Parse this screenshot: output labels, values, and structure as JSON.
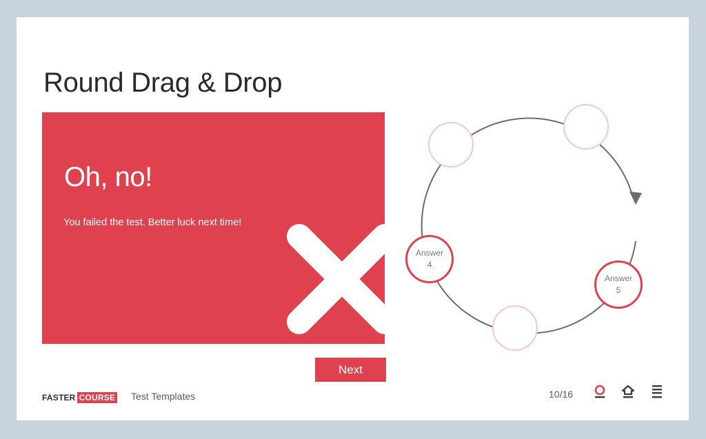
{
  "slide": {
    "title": "Round Drag & Drop"
  },
  "feedback": {
    "heading": "Oh, no!",
    "message": "You failed the test. Better luck next time!",
    "icon": "x-mark-icon"
  },
  "next_button": {
    "label": "Next"
  },
  "drop_zones": [
    {
      "state": "empty"
    },
    {
      "state": "empty"
    },
    {
      "state": "empty"
    },
    {
      "state": "filled",
      "label": "Answer",
      "number": "4"
    },
    {
      "state": "filled",
      "label": "Answer",
      "number": "5"
    }
  ],
  "answers": [
    {
      "label": "Answer",
      "number": "4"
    },
    {
      "label": "Answer",
      "number": "5"
    }
  ],
  "footer": {
    "logo_part1": "FASTER",
    "logo_part2": "COURSE",
    "course_name": "Test Templates",
    "page_counter": "10/16",
    "icons": [
      "lifebuoy-icon",
      "home-icon",
      "menu-icon"
    ]
  },
  "colors": {
    "accent": "#df414e",
    "background": "#c9d3de",
    "slot_outline": "#f4c9c5",
    "circle_line": "#6b6b6b"
  }
}
